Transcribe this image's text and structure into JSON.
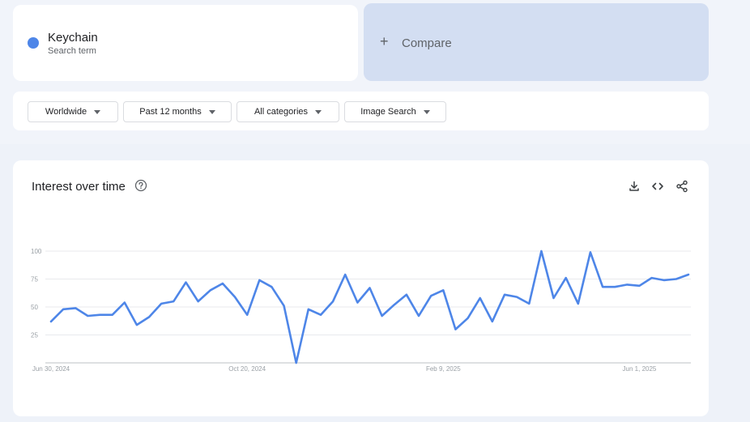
{
  "search_term": {
    "name": "Keychain",
    "type": "Search term",
    "color": "#4e86e8"
  },
  "compare": {
    "plus": "+",
    "label": "Compare"
  },
  "filters": {
    "region": "Worldwide",
    "time_range": "Past 12 months",
    "category": "All categories",
    "property": "Image Search"
  },
  "panel": {
    "title": "Interest over time",
    "icons": [
      "help-icon",
      "download-icon",
      "embed-icon",
      "share-icon"
    ]
  },
  "chart_data": {
    "type": "line",
    "title": "",
    "xlabel": "",
    "ylabel": "",
    "ylim": [
      0,
      100
    ],
    "yticks": [
      25,
      50,
      75,
      100
    ],
    "x_tick_labels": [
      "Jun 30, 2024",
      "Oct 20, 2024",
      "Feb 9, 2025",
      "Jun 1, 2025"
    ],
    "x_tick_indices": [
      0,
      16,
      32,
      48
    ],
    "grid": true,
    "series": [
      {
        "color": "#4e86e8",
        "values": [
          37,
          48,
          49,
          42,
          43,
          43,
          54,
          34,
          41,
          53,
          55,
          72,
          55,
          65,
          71,
          59,
          43,
          74,
          68,
          51,
          0,
          48,
          43,
          55,
          79,
          54,
          67,
          42,
          52,
          61,
          42,
          60,
          65,
          30,
          40,
          58,
          37,
          61,
          59,
          53,
          100,
          58,
          76,
          53,
          99,
          68,
          68,
          70,
          69,
          76,
          74,
          75,
          79
        ]
      }
    ]
  }
}
